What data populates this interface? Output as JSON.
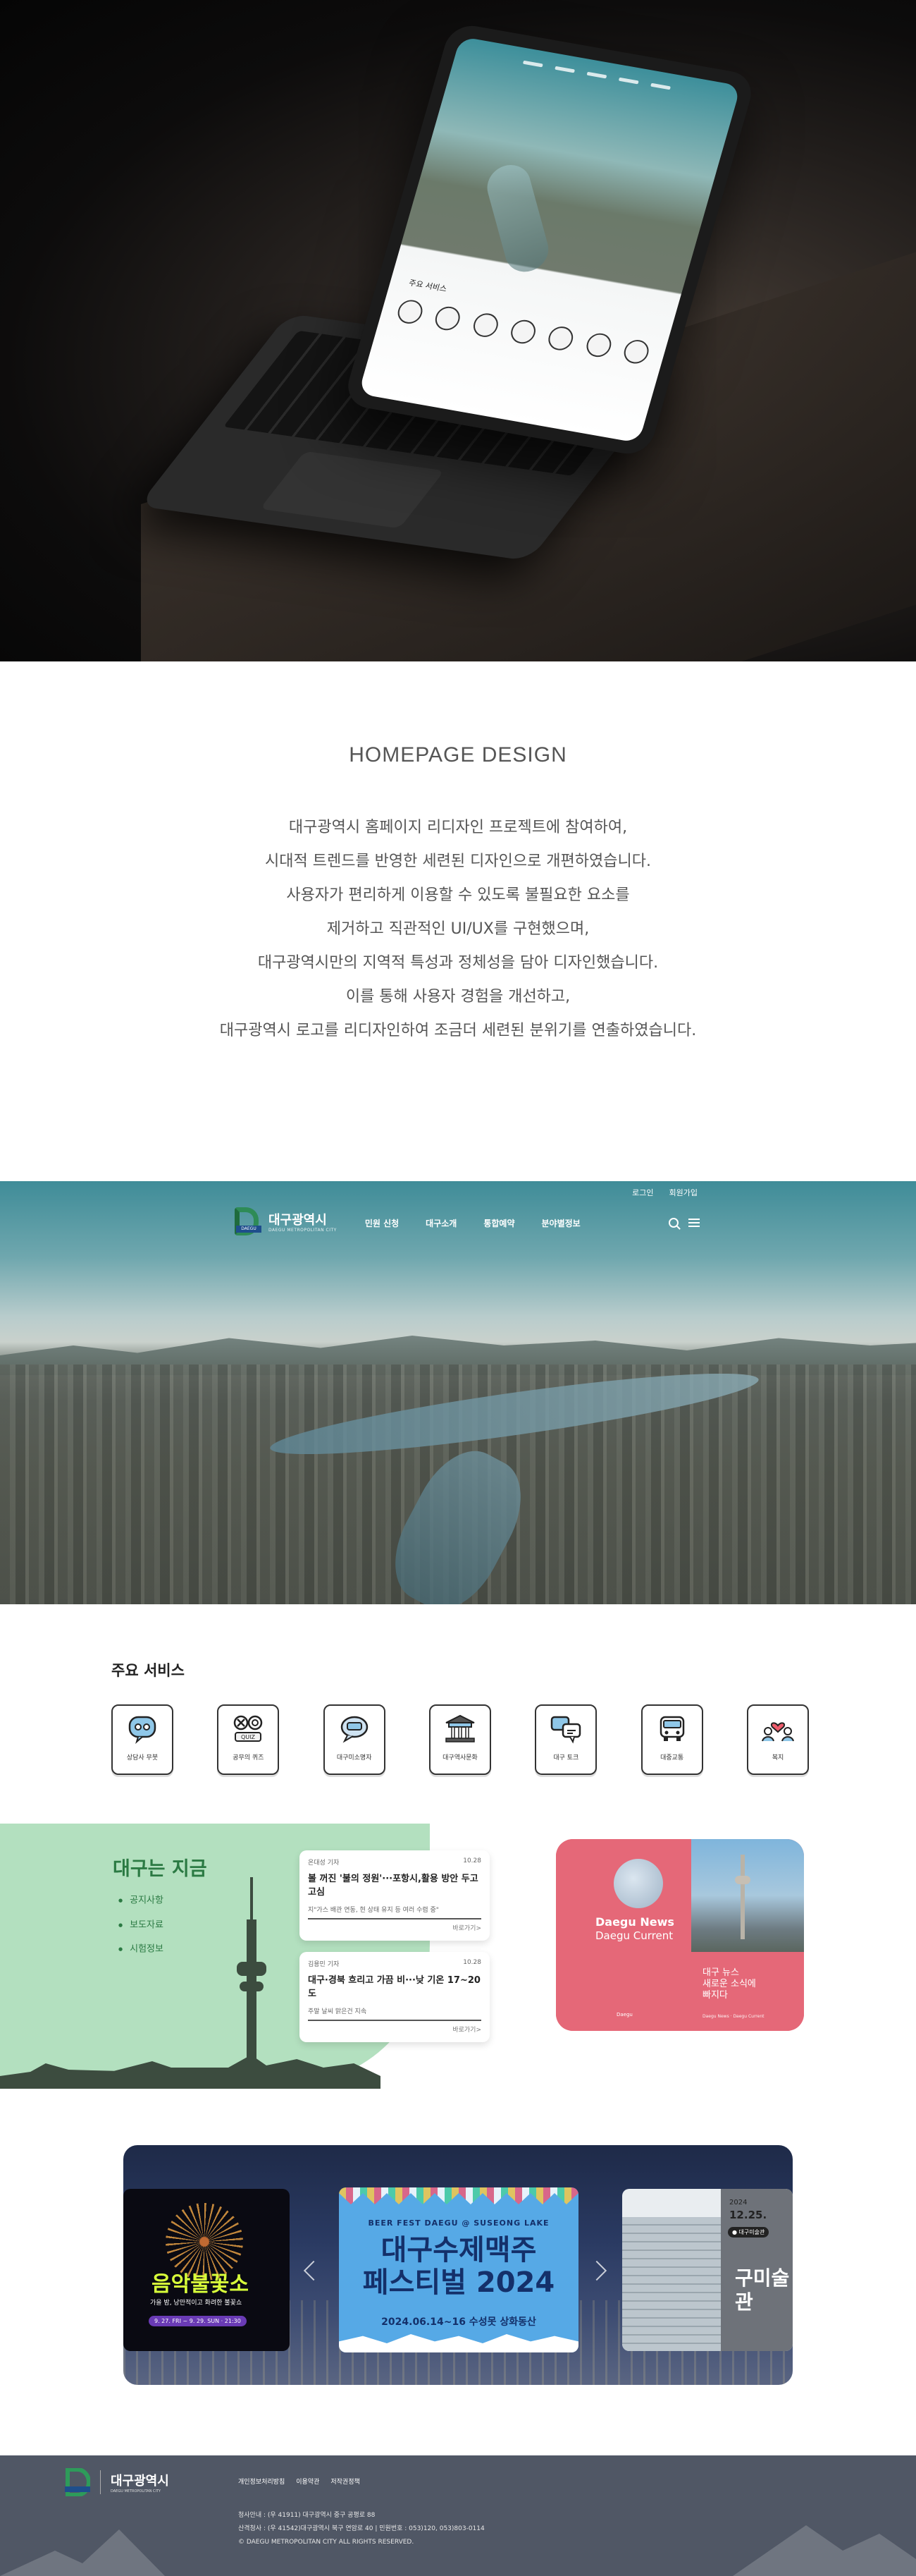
{
  "intro": {
    "heading": "HOMEPAGE DESIGN",
    "lines": [
      "대구광역시 홈페이지 리디자인 프로젝트에 참여하여,",
      "시대적 트렌드를 반영한 세련된 디자인으로 개편하였습니다.",
      "사용자가 편리하게 이용할 수 있도록 불필요한 요소를",
      "제거하고 직관적인 UI/UX를 구현했으며,",
      "대구광역시만의 지역적 특성과 정체성을 담아 디자인했습니다.",
      "이를 통해 사용자 경험을 개선하고,",
      "대구광역시 로고를 리디자인하여 조금더 세련된 분위기를 연출하였습니다."
    ]
  },
  "header": {
    "util_links": [
      "로그인",
      "회원가입"
    ],
    "logo_name": "대구광역시",
    "logo_tag": "DAEGU",
    "logo_sub": "DAEGU METROPOLITAN CITY",
    "menu": [
      "민원 신청",
      "대구소개",
      "통합예약",
      "분야별정보"
    ]
  },
  "services": {
    "title": "주요 서비스",
    "items": [
      {
        "label": "상담사 무붓",
        "icon": "chat-robot-icon"
      },
      {
        "label": "공무의 퀴즈",
        "icon": "quiz-icon"
      },
      {
        "label": "대구미소명자",
        "icon": "speech-bubble-icon"
      },
      {
        "label": "대구역사문화",
        "icon": "temple-icon"
      },
      {
        "label": "대구 토크",
        "icon": "talk-icon"
      },
      {
        "label": "대중교통",
        "icon": "bus-icon"
      },
      {
        "label": "복지",
        "icon": "people-heart-icon"
      }
    ]
  },
  "now": {
    "title": "대구는 지금",
    "links": [
      "공지사항",
      "보도자료",
      "시험정보"
    ],
    "cards": [
      {
        "source": "온대성 기자",
        "date": "10.28",
        "title": "볼 꺼진 '불의 정원'···포항시,활용 방안 두고 고심",
        "body": "지\"가스 배관 연동, 현 상태 유지 등 여러 수렴 중\"",
        "more": "바로가기>"
      },
      {
        "source": "김용민 기자",
        "date": "10.28",
        "title": "대구·경북 흐리고 가끔 비···낮 기온 17~20도",
        "body": "주말 날씨 맑은건 지속",
        "more": "바로가기>"
      }
    ]
  },
  "daegu_news": {
    "title": "Daegu News",
    "subtitle": "Daegu Current",
    "tagline_1": "대구 뉴스",
    "tagline_2": "새로운 소식에",
    "tagline_3": "빠지다",
    "logo": "Daegu",
    "footer": "Daegu News · Daegu Current"
  },
  "slider": {
    "left": {
      "title": "음악불꽃소",
      "sub": "가을 밤, 낭만적이고 화려한 불꽃쇼",
      "date": "9. 27. FRI ~ 9. 29. SUN · 21:30"
    },
    "center": {
      "eyebrow": "BEER FEST DAEGU @ SUSEONG LAKE",
      "title_1": "대구수제맥주",
      "title_2": "페스티벌 2024",
      "date": "2024.06.14~16  수성못 상화동산"
    },
    "right": {
      "year": "2024",
      "date": "12.25.",
      "place": "● 대구미술관",
      "big_1": "구미술",
      "big_2": "관"
    }
  },
  "footer": {
    "logo_name": "대구광역시",
    "logo_sub": "DAEGU METROPOLITAN CITY",
    "links": [
      "개인정보처리방침",
      "이용약관",
      "저작권정책"
    ],
    "info": [
      "청사안내 : (우 41911) 대구광역시 중구 공평로 88",
      "산격청사 : (우 41542)대구광역시 북구 연암로 40 | 민원번호 : 053)120, 053)803-0114",
      "© DAEGU METROPOLITAN CITY ALL RIGHTS RESERVED."
    ]
  },
  "colors": {
    "accent_green": "#2b7a43",
    "mint_bg": "#b3e0bf",
    "pink_card": "#e56878",
    "footer_bg": "#505765"
  }
}
